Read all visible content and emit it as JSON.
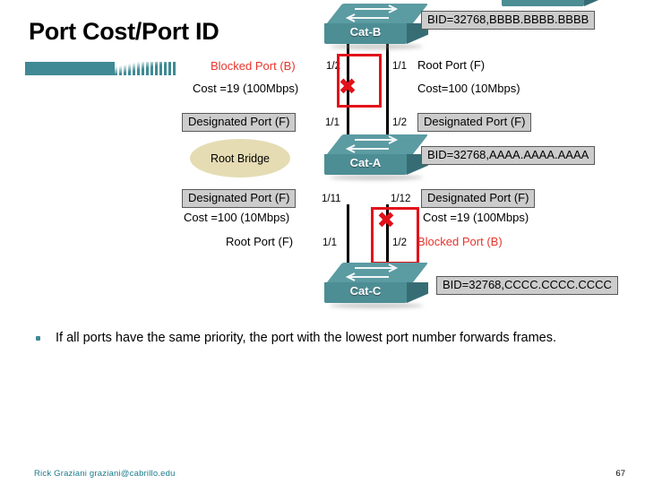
{
  "slide": {
    "title": "Port Cost/Port ID",
    "bullet": "If all ports have the same priority, the port with the lowest port number forwards frames."
  },
  "footer": {
    "credit": "Rick Graziani  graziani@cabrillo.edu",
    "page_number": "67"
  },
  "colors": {
    "accent_teal": "#3f8a94",
    "switch_body": "#4d8d94",
    "blocked_red": "#e2121a",
    "root_bridge_fill": "#e5dcb4",
    "label_box_fill": "#cccccc",
    "footer_link": "#1d7b8c"
  },
  "diagram": {
    "switches": [
      {
        "id": "cat-b",
        "name": "Cat-B",
        "bid": "BID=32768,BBBB.BBBB.BBBB"
      },
      {
        "id": "cat-a",
        "name": "Cat-A",
        "bid": "BID=32768,AAAA.AAAA.AAAA"
      },
      {
        "id": "cat-c",
        "name": "Cat-C",
        "bid": "BID=32768,CCCC.CCCC.CCCC"
      }
    ],
    "root_bridge_label": "Root Bridge",
    "cat_b": {
      "left_role": "Blocked Port (B)",
      "left_port": "1/2",
      "left_cost": "Cost =19 (100Mbps)",
      "right_port": "1/1",
      "right_role": "Root Port (F)",
      "right_cost": "Cost=100 (10Mbps)"
    },
    "cat_a": {
      "upper_left_role": "Designated Port (F)",
      "upper_left_port": "1/1",
      "upper_right_port": "1/2",
      "upper_right_role": "Designated Port (F)",
      "lower_left_role": "Designated Port (F)",
      "lower_left_port": "1/11",
      "lower_right_port": "1/12",
      "lower_right_role": "Designated Port (F)"
    },
    "cat_c": {
      "left_cost": "Cost =100 (10Mbps)",
      "left_role": "Root Port (F)",
      "left_port": "1/1",
      "right_cost": "Cost =19 (100Mbps)",
      "right_port": "1/2",
      "right_role": "Blocked Port (B)"
    },
    "blocked_marker": "✖"
  }
}
